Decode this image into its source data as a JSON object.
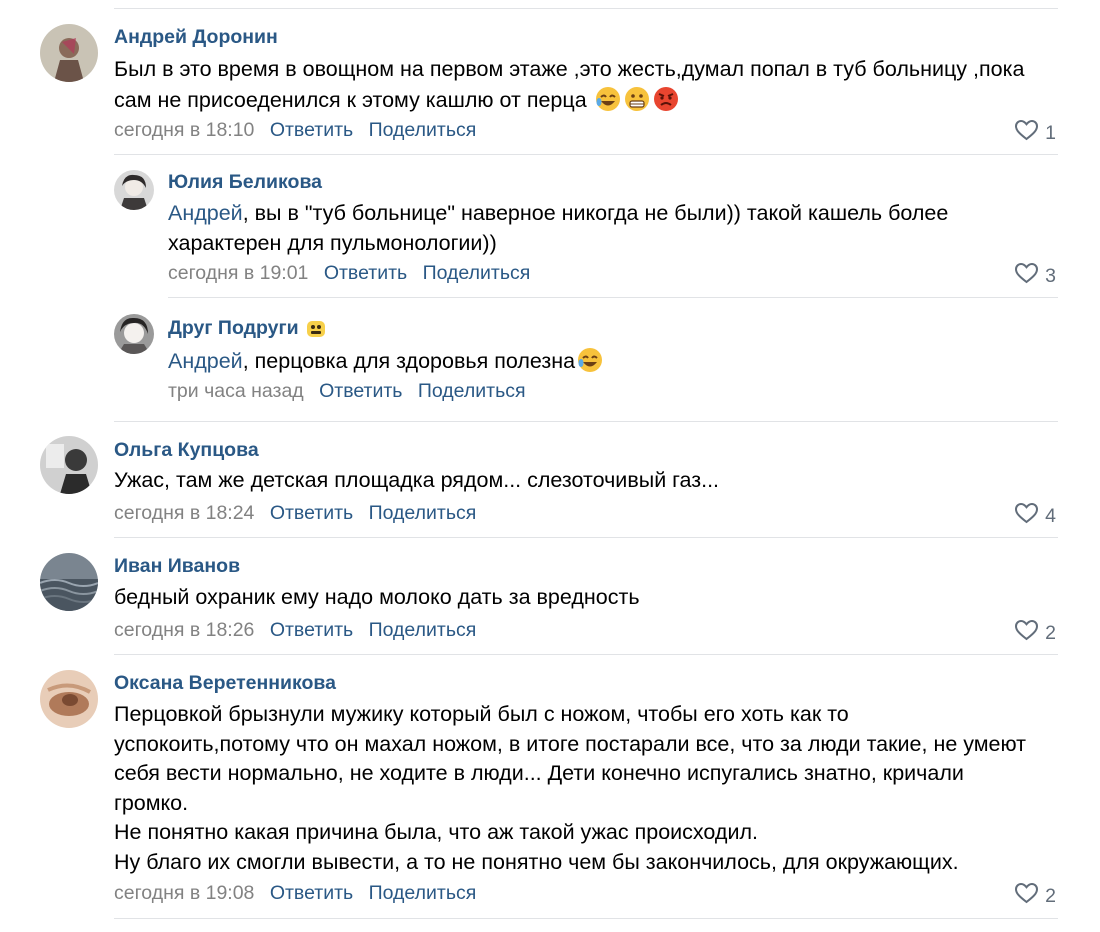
{
  "comments": [
    {
      "author": "Андрей Доронин",
      "text_lines": [
        "Был в это время в овощном на первом этаже ,это жесть,думал попал в туб больницу ,пока",
        "сам не присоеденился к этому кашлю от перца"
      ],
      "time": "сегодня в 18:10",
      "reply_label": "Ответить",
      "share_label": "Поделиться",
      "likes": "1"
    },
    {
      "author": "Юлия Беликова",
      "mention": "Андрей",
      "text_lines": [
        ", вы в \"туб больнице\" наверное никогда не были)) такой кашель более",
        "характерен для пульмонологии))"
      ],
      "time": "сегодня в 19:01",
      "reply_label": "Ответить",
      "share_label": "Поделиться",
      "likes": "3"
    },
    {
      "author": "Друг Подруги",
      "mention": "Андрей",
      "text_lines": [
        ", перцовка для здоровья полезна"
      ],
      "time": "три часа назад",
      "reply_label": "Ответить",
      "share_label": "Поделиться"
    },
    {
      "author": "Ольга Купцова",
      "text_lines": [
        "Ужас, там же детская площадка рядом... слезоточивый газ..."
      ],
      "time": "сегодня в 18:24",
      "reply_label": "Ответить",
      "share_label": "Поделиться",
      "likes": "4"
    },
    {
      "author": "Иван Иванов",
      "text_lines": [
        "бедный охраник ему надо молоко дать за вредность"
      ],
      "time": "сегодня в 18:26",
      "reply_label": "Ответить",
      "share_label": "Поделиться",
      "likes": "2"
    },
    {
      "author": "Оксана Веретенникова",
      "text_lines": [
        "Перцовкой брызнули мужику который был с ножом, чтобы его хоть как то",
        "успокоить,потому что он махал ножом, в итоге постарали все, что за люди такие, не умеют",
        "себя вести нормально, не ходите в люди... Дети конечно испугались знатно, кричали",
        "громко.",
        "Не понятно какая причина была, что аж такой ужас происходил.",
        "Ну благо их смогли вывести, а то не понятно чем бы закончилось, для окружающих."
      ],
      "time": "сегодня в 19:08",
      "reply_label": "Ответить",
      "share_label": "Поделиться",
      "likes": "2"
    }
  ],
  "colors": {
    "link": "#2a5885",
    "meta": "#828282",
    "separator": "#e1e3e6"
  },
  "icons": {
    "like": "heart-outline-icon",
    "emoji": [
      "rofl-emoji-icon",
      "grimacing-emoji-icon",
      "angry-emoji-icon"
    ]
  }
}
